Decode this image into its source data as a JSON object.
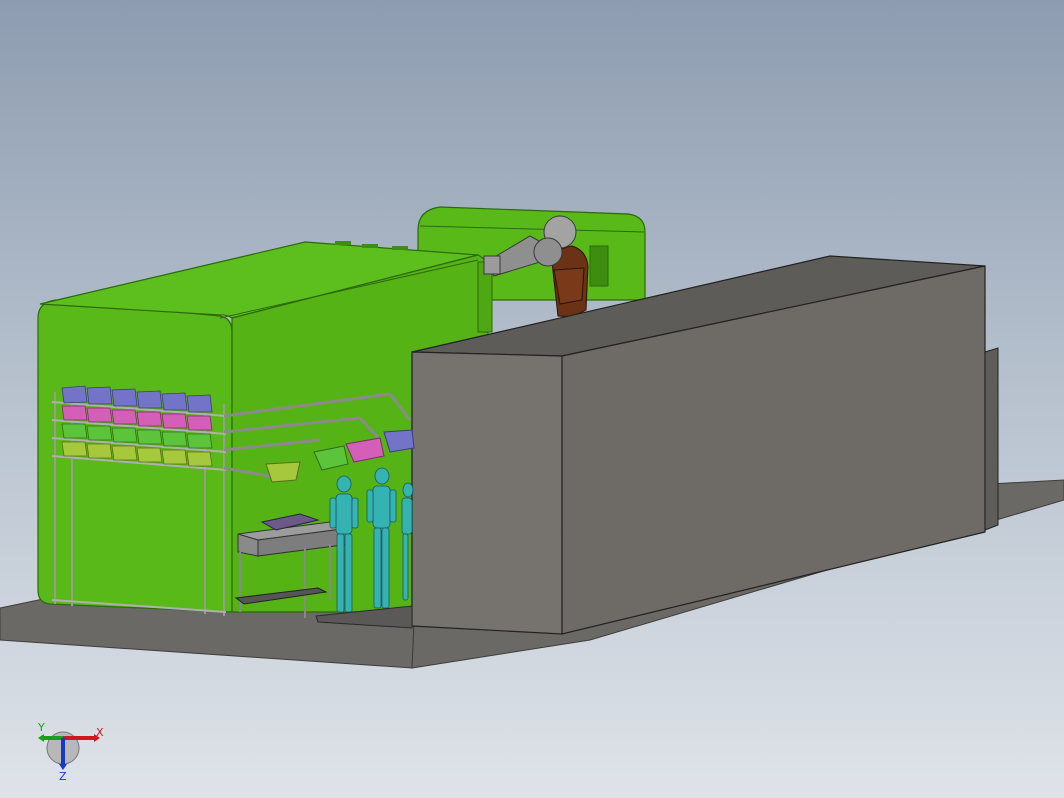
{
  "viewport": {
    "background_top": "#8d9cb0",
    "background_bottom": "#dfe3e9"
  },
  "scene": {
    "colors": {
      "machine_green": "#58b918",
      "machine_green_dark": "#3d8e0e",
      "enclosure_front": "#6e6b67",
      "enclosure_top": "#5e5c59",
      "floor": "#6a6966",
      "robot_grey": "#8f8f8f",
      "robot_brown": "#6b3216",
      "operator_cyan": "#35b3b3",
      "bin_blue": "#7373c8",
      "bin_pink": "#d45fb8",
      "bin_green": "#5cc43a",
      "bin_lime": "#a6c83c"
    }
  },
  "triad": {
    "x_label": "X",
    "y_label": "Y",
    "z_label": "Z",
    "x_color": "#d01818",
    "y_color": "#18a018",
    "z_color": "#1838c8"
  }
}
